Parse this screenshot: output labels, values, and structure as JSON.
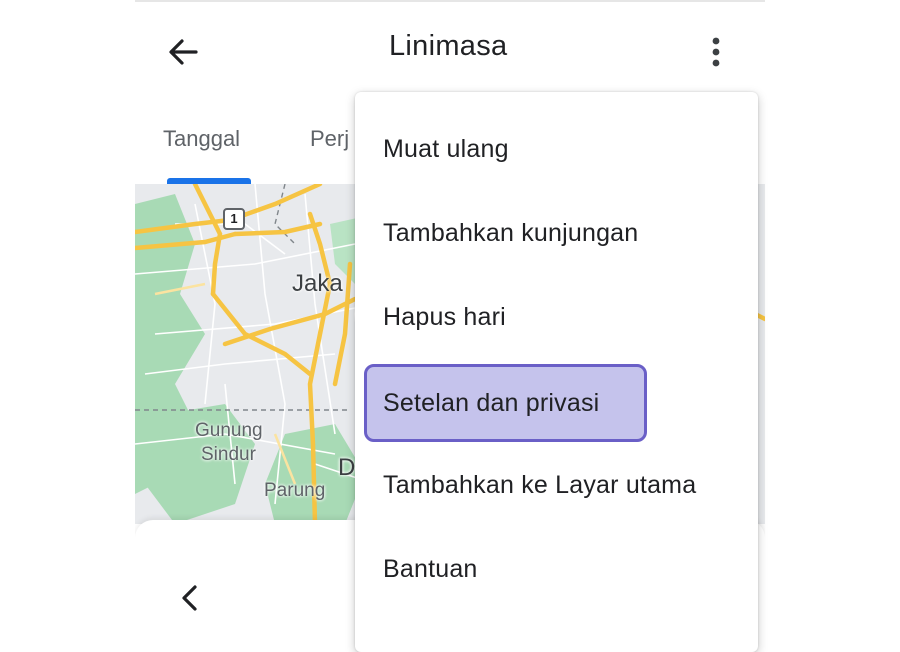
{
  "app": {
    "title": "Linimasa"
  },
  "icons": {
    "back": "arrow-left-icon",
    "more": "more-vert-icon",
    "prev": "chevron-left-icon"
  },
  "tabs": [
    {
      "label": "Tanggal",
      "active": true
    },
    {
      "label": "Perj",
      "active": false
    }
  ],
  "map": {
    "labels": {
      "city": "Jaka",
      "gunung": "Gunung",
      "sindur": "Sindur",
      "parung": "Parung",
      "d": "D",
      "road_shield": "1"
    }
  },
  "menu": {
    "items": [
      {
        "label": "Muat ulang"
      },
      {
        "label": "Tambahkan kunjungan"
      },
      {
        "label": "Hapus hari"
      },
      {
        "label": "Setelan dan privasi",
        "highlighted": true
      },
      {
        "label": "Tambahkan ke Layar utama"
      },
      {
        "label": "Bantuan"
      }
    ]
  },
  "colors": {
    "accent": "#1a73e8",
    "highlight_fill": "#c5c3ec",
    "highlight_border": "#6a5fc7",
    "road": "#f6c443",
    "park": "#a8dab5"
  }
}
